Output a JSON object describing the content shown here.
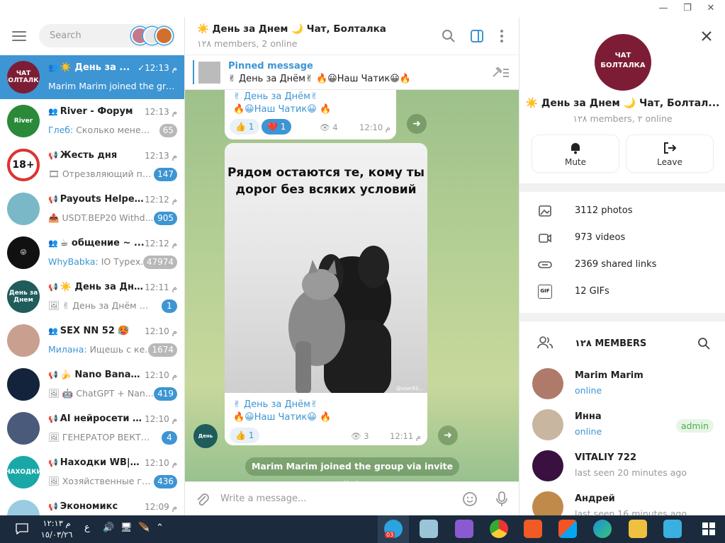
{
  "window": {
    "minimize": "—",
    "maximize": "❐",
    "close": "✕"
  },
  "left": {
    "search_placeholder": "Search",
    "chats": [
      {
        "name": "☀️ День за ...",
        "time": "✓12:13 م",
        "msg": "Marim Marim joined the gro...",
        "type": "👥",
        "badge": "",
        "active": true,
        "ava_text": "ЧАТ БОЛТАЛКА",
        "ava_color": "#7d1d35"
      },
      {
        "name": "River - Форум",
        "time": "م 12:13",
        "sender": "Глеб:",
        "msg": " Сколько менедж...",
        "type": "👥",
        "badge": "65",
        "muted": true,
        "ava_text": "River",
        "ava_color": "#2a8a3a"
      },
      {
        "name": "Жесть дня",
        "time": "م 12:13",
        "msg": "🎞 Отрезвляющий пе...",
        "type": "📢",
        "badge": "147",
        "ava_text": "18+",
        "ava_color": "#ffffff"
      },
      {
        "name": "Payouts Helper™",
        "time": "م 12:12",
        "msg": "📤 USDT.BEP20 Withd...",
        "type": "📢",
        "badge": "905",
        "ava_text": "",
        "ava_color": "#7ab8c8"
      },
      {
        "name": "☕ общение ~ ...",
        "time": "م 12:12",
        "sender": "WhyBabka:",
        "msg": " IO Турех...",
        "type": "👥",
        "badge": "47974",
        "muted": true,
        "ava_text": "😜",
        "ava_color": "#111111"
      },
      {
        "name": "☀️ День за Дне...",
        "time": "م 12:11",
        "msg": "🖼 ✌ День за Днём ✌...",
        "type": "📢",
        "badge": "1",
        "ava_text": "День за Днем",
        "ava_color": "#1f5c5c"
      },
      {
        "name": "SEX NN 52 🥵",
        "time": "م 12:10",
        "sender": "Милана:",
        "msg": " Ищешь с ке...",
        "type": "👥",
        "badge": "1674",
        "muted": true,
        "ava_text": "",
        "ava_color": "#c9a08f"
      },
      {
        "name": "🍌 Nano Banan...",
        "time": "م 12:10",
        "msg": "🖼 🤖 ChatGPT + Nan...",
        "type": "📢",
        "badge": "419",
        "ava_text": "",
        "ava_color": "#14233c"
      },
      {
        "name": "AI нейросети и ...",
        "time": "م 12:10",
        "msg": "🖼 ГЕНЕРАТОР ВЕКТОР...",
        "type": "📢",
        "badge": "4",
        "ava_text": "",
        "ava_color": "#4a5a7a"
      },
      {
        "name": "Находки WB|OZ...",
        "time": "م 12:10",
        "msg": "🖼 Хозяйственные гу...",
        "type": "📢",
        "badge": "436",
        "ava_text": "НАХОДКИ",
        "ava_color": "#1aa7a7"
      },
      {
        "name": "Экономикс",
        "time": "م 12:09",
        "msg": "",
        "type": "📢",
        "badge": "",
        "ava_text": "",
        "ava_color": "#9acbe0"
      }
    ]
  },
  "middle": {
    "title": "☀️ День за Днем 🌙 Чат, Болталка",
    "subtitle": "١٢٨ members, 2 online",
    "pinned_title": "Pinned message",
    "pinned_text": "✌ День за Днём✌ 🔥😀Наш Чатик😀🔥",
    "msg1_line1": "✌ День за Днём✌",
    "msg1_line2": "🔥😀Наш Чатик😀 🔥",
    "msg1_r1": "👍 1",
    "msg1_r2": "❤️ 1",
    "msg1_views": "👁 4",
    "msg1_time": "م 12:10",
    "photo_text": "Рядом остаются те, кому ты дорог без всяких условий",
    "photo_credit": "@user93...",
    "msg2_line1": "✌ День за Днём✌",
    "msg2_line2": "🔥😀Наш Чатик😀 🔥",
    "msg2_r1": "👍 1",
    "msg2_views": "👁 3",
    "msg2_time": "م 12:11",
    "service": "Marim Marim joined the group via invite link",
    "compose_placeholder": "Write a message..."
  },
  "right": {
    "ava_text": "ЧАТ БОЛТАЛКА",
    "title": "☀️ День за Днем 🌙 Чат, Болтал...",
    "subtitle": "١٢٨ members, ٢ online",
    "mute": "Mute",
    "leave": "Leave",
    "photos": "3112 photos",
    "videos": "973 videos",
    "links": "2369 shared links",
    "gifs": "12 GIFs",
    "gif_icon": "GIF",
    "members_title": "١٢٨ MEMBERS",
    "members": [
      {
        "name": "Marim Marim",
        "status": "online",
        "online": true,
        "color": "#b07a6a"
      },
      {
        "name": "Инна",
        "status": "online",
        "online": true,
        "tag": "admin",
        "color": "#c8b6a0"
      },
      {
        "name": "VITALIY 722",
        "status": "last seen 20 minutes ago",
        "color": "#3a1040"
      },
      {
        "name": "Андрей",
        "status": "last seen 16 minutes ago",
        "color": "#c08a4a"
      }
    ]
  },
  "taskbar": {
    "time": "م ١٢:١٣",
    "date": "١٥/٠٣/٢٦",
    "lang": "ع",
    "tg_badge": "03"
  }
}
